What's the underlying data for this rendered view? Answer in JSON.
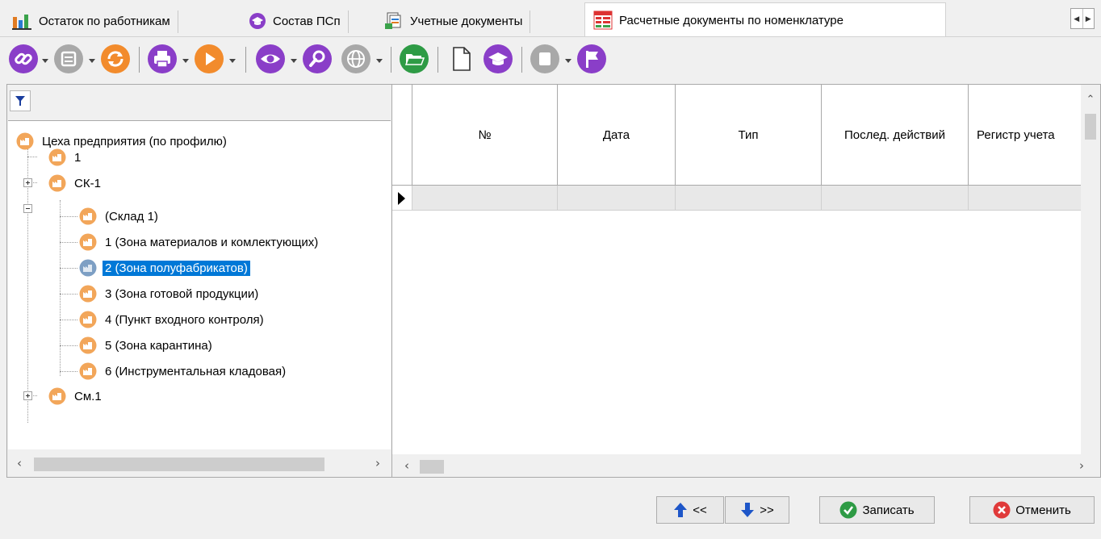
{
  "tabs": [
    {
      "label": "Остаток по работникам",
      "icon": "workers-chart-icon",
      "active": false
    },
    {
      "label": "Состав ПСп",
      "icon": "graduation-cap-icon",
      "active": false
    },
    {
      "label": "Учетные документы",
      "icon": "documents-icon",
      "active": false
    },
    {
      "label": "Расчетные документы по номенклатуре",
      "icon": "spreadsheet-icon",
      "active": true
    }
  ],
  "toolbar": [
    {
      "icon": "link-icon",
      "color": "#8a3ec8",
      "dropdown": true
    },
    {
      "icon": "record-icon",
      "color": "#9e9e9e",
      "dropdown": true
    },
    {
      "icon": "refresh-icon",
      "color": "#f28b2c",
      "dropdown": false
    },
    {
      "icon": "print-icon",
      "color": "#8a3ec8",
      "dropdown": true
    },
    {
      "icon": "play-icon",
      "color": "#f28b2c",
      "dropdown": true
    },
    {
      "icon": "view-icon",
      "color": "#8a3ec8",
      "dropdown": true
    },
    {
      "icon": "search-icon",
      "color": "#8a3ec8",
      "dropdown": false
    },
    {
      "icon": "globe-icon",
      "color": "#9e9e9e",
      "dropdown": true
    },
    {
      "icon": "open-folder-icon",
      "color": "#2e9b45",
      "dropdown": false
    },
    {
      "icon": "new-document-icon",
      "color": "#333333",
      "dropdown": false
    },
    {
      "icon": "graduation-cap-icon",
      "color": "#8a3ec8",
      "dropdown": false
    },
    {
      "icon": "stop-icon",
      "color": "#9e9e9e",
      "dropdown": true
    },
    {
      "icon": "flag-icon",
      "color": "#8a3ec8",
      "dropdown": false
    }
  ],
  "tree": {
    "root": "Цеха предприятия (по профилю)",
    "n1": "1",
    "ck1": "СК-1",
    "children": [
      "(Склад 1)",
      "1 (Зона материалов и комлектующих)",
      "2 (Зона полуфабрикатов)",
      "3 (Зона готовой продукции)",
      "4 (Пункт входного контроля)",
      "5 (Зона карантина)",
      "6 (Инструментальная кладовая)"
    ],
    "cm1": "См.1",
    "selected_index": 2
  },
  "grid": {
    "columns": [
      "№",
      "Дата",
      "Тип",
      "Послед. действий",
      "Регистр учета"
    ]
  },
  "buttons": {
    "prev": "<<",
    "next": ">>",
    "save": "Записать",
    "cancel": "Отменить"
  },
  "colors": {
    "accent_purple": "#8a3ec8",
    "accent_orange": "#f28b2c",
    "selection": "#0078d7",
    "success_green": "#2e9b45",
    "cancel_red": "#e03a3a"
  }
}
